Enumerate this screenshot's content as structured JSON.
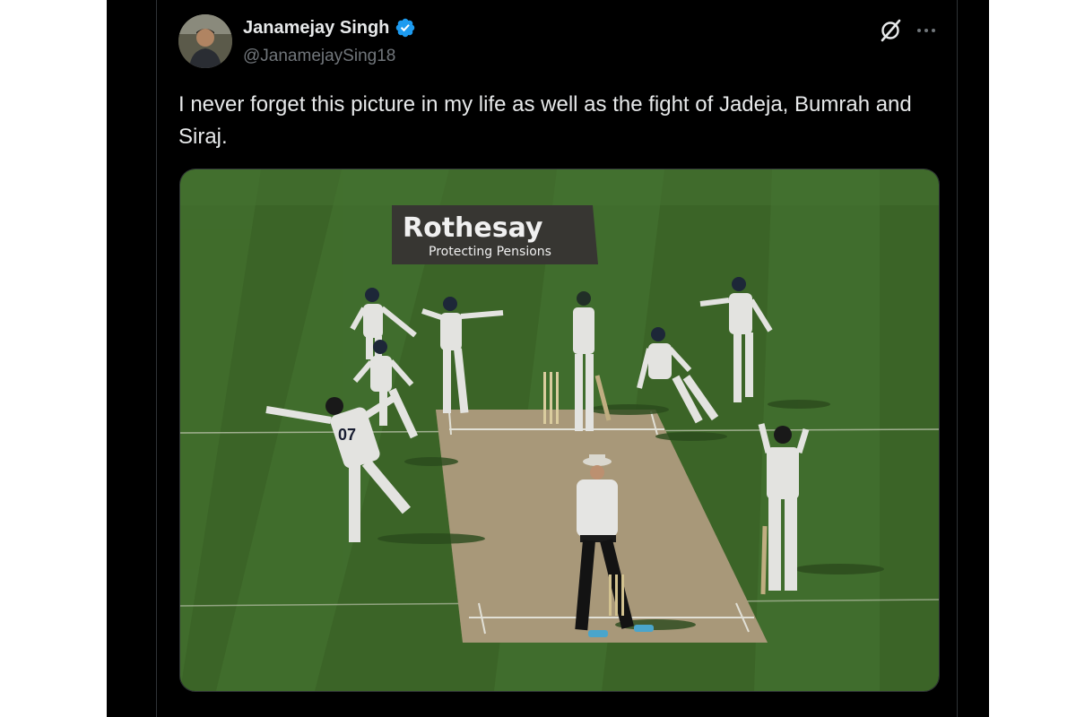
{
  "user": {
    "name": "Janamejay Singh",
    "handle": "@JanamejaySing18",
    "verified": true
  },
  "tweet": {
    "text": "I never forget this picture in my life as well as the fight of Jadeja, Bumrah and Siraj."
  },
  "media": {
    "sponsor_brand": "Rothesay",
    "sponsor_tagline": "Protecting Pensions",
    "jersey_number": "07"
  },
  "icons": {
    "verified": "verified-badge-icon",
    "grok": "grok-icon",
    "more": "more-options-icon"
  },
  "colors": {
    "background": "#000000",
    "text_primary": "#e7e9ea",
    "text_secondary": "#71767b",
    "verified_blue": "#1d9bf0"
  }
}
